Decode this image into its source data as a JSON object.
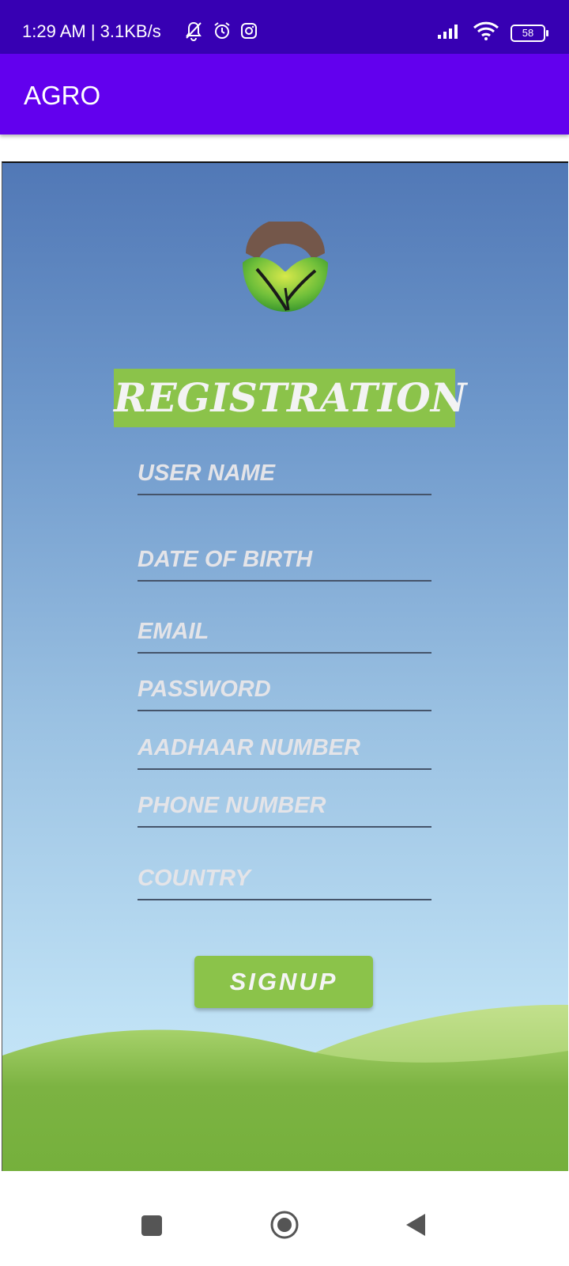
{
  "status_bar": {
    "time_text": "1:29 AM | 3.1KB/s",
    "battery_level": "58",
    "icons": [
      "notification-muted-icon",
      "alarm-icon",
      "instagram-icon",
      "signal-icon",
      "wifi-icon",
      "battery-icon"
    ]
  },
  "app_bar": {
    "title": "AGRO",
    "color": "#6200ee"
  },
  "registration": {
    "title": "REGISTRATION",
    "fields": {
      "username_placeholder": "USER NAME",
      "dob_placeholder": "DATE OF BIRTH",
      "email_placeholder": "EMAIL",
      "password_placeholder": "PASSWORD",
      "aadhaar_placeholder": "AADHAAR NUMBER",
      "phone_placeholder": "PHONE NUMBER",
      "country_placeholder": "COUNTRY"
    },
    "signup_label": "SIGNUP",
    "accent_color": "#8bc34a"
  },
  "nav_bar": {
    "icons": [
      "recents-square-icon",
      "home-circle-icon",
      "back-triangle-icon"
    ]
  }
}
